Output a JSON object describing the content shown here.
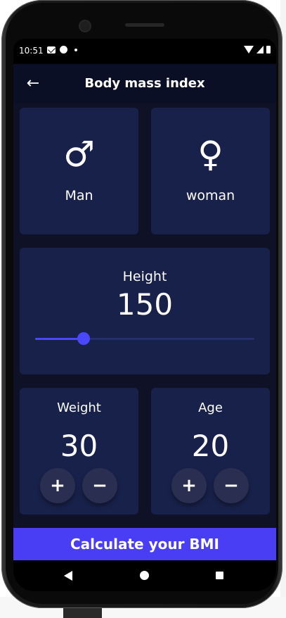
{
  "status_bar": {
    "time": "10:51",
    "left_icons": [
      "mail-icon",
      "app-circle-icon",
      "notification-dot-icon"
    ],
    "right_icons": [
      "wifi-icon",
      "signal-icon",
      "battery-icon"
    ]
  },
  "app_bar": {
    "title": "Body mass index",
    "back_glyph": "←"
  },
  "gender": {
    "male": {
      "symbol": "♂",
      "label": "Man"
    },
    "female": {
      "symbol": "♀",
      "label": "woman"
    }
  },
  "height": {
    "label": "Height",
    "value": "150",
    "slider_fraction": 0.22
  },
  "weight": {
    "label": "Weight",
    "value": "30",
    "plus_glyph": "+",
    "minus_glyph": "−"
  },
  "age": {
    "label": "Age",
    "value": "20",
    "plus_glyph": "+",
    "minus_glyph": "−"
  },
  "calculate_button": {
    "label": "Calculate your BMI"
  },
  "nav_bar": {
    "icons": [
      "nav-back-icon",
      "nav-home-icon",
      "nav-recents-icon"
    ]
  },
  "colors": {
    "background": "#0f1227",
    "card": "#18214a",
    "accent": "#4a47ff",
    "button": "#4a3ef5",
    "round_button": "#2a2f52"
  }
}
